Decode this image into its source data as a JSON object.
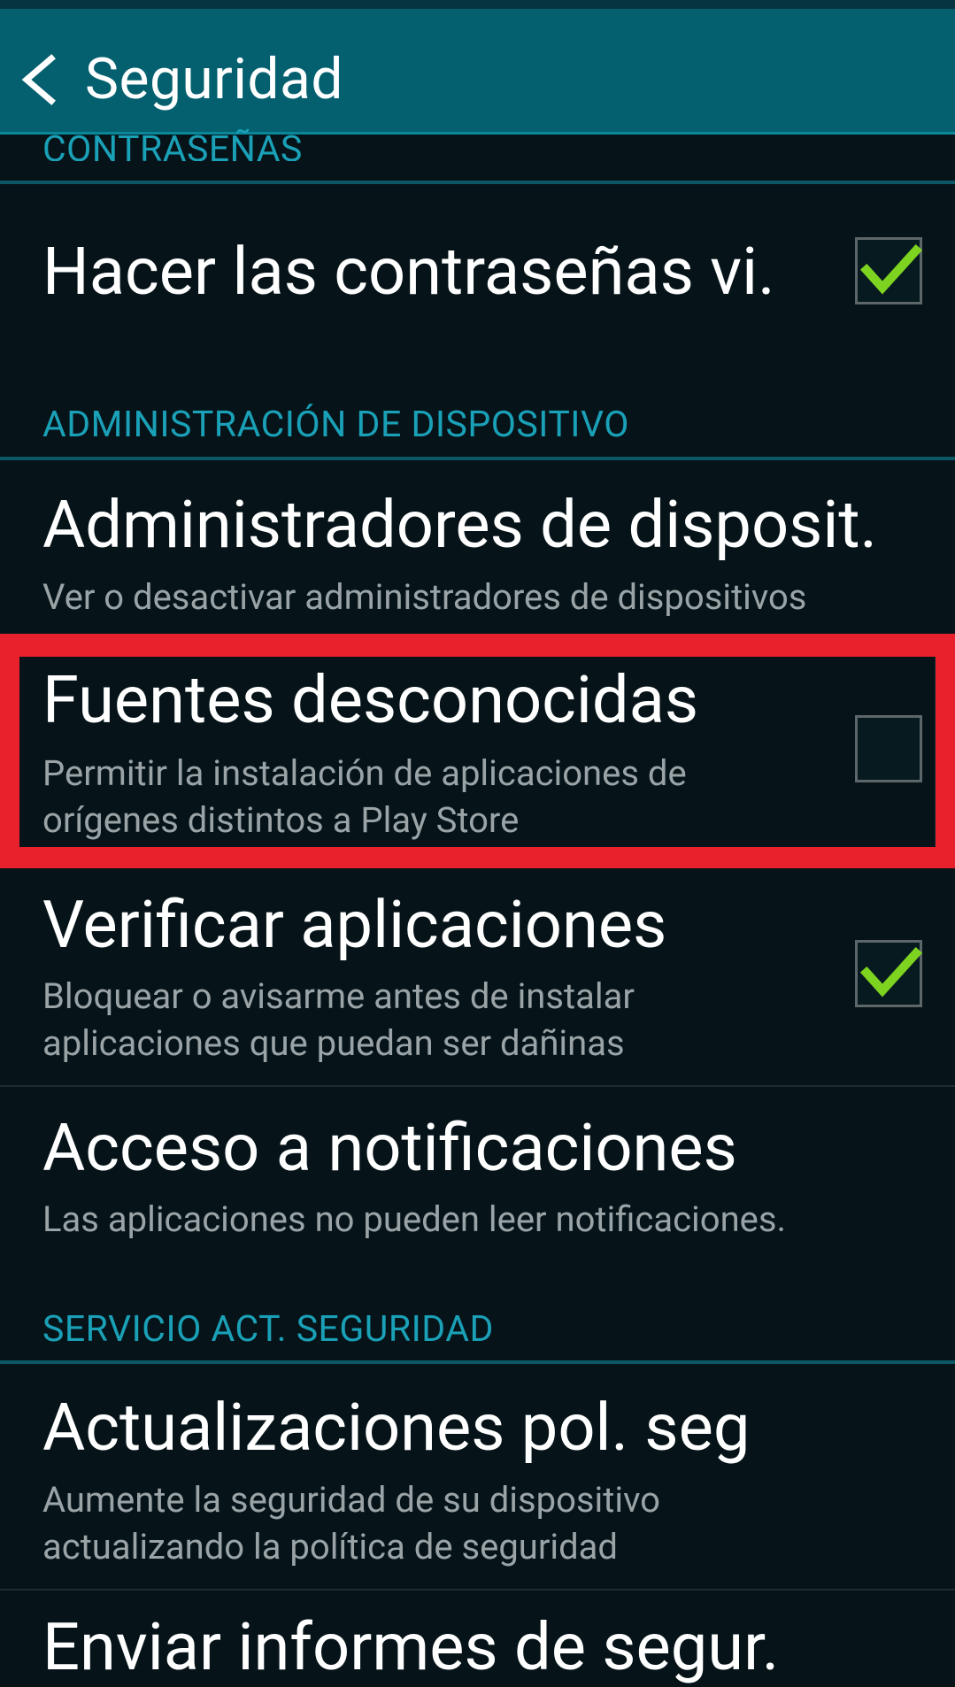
{
  "header": {
    "title": "Seguridad"
  },
  "sections": {
    "passwords": "CONTRASEÑAS",
    "device_admin": "ADMINISTRACIÓN DE DISPOSITIVO",
    "security_service": "SERVICIO ACT. SEGURIDAD"
  },
  "items": {
    "show_passwords": {
      "title": "Hacer las contraseñas vi.",
      "checked": true
    },
    "device_admins": {
      "title": "Administradores de disposit.",
      "summary": "Ver o desactivar administradores de dispositivos"
    },
    "unknown_sources": {
      "title": "Fuentes desconocidas",
      "summary_line1": "Permitir la instalación de aplicaciones de",
      "summary_line2": "orígenes distintos a Play Store",
      "checked": false
    },
    "verify_apps": {
      "title": "Verificar aplicaciones",
      "summary_line1": "Bloquear o avisarme antes de instalar",
      "summary_line2": "aplicaciones que puedan ser dañinas",
      "checked": true
    },
    "notification_access": {
      "title": "Acceso a notificaciones",
      "summary": "Las aplicaciones no pueden leer notificaciones."
    },
    "policy_updates": {
      "title": "Actualizaciones pol. seg",
      "summary_line1": "Aumente la seguridad de su dispositivo",
      "summary_line2": "actualizando la política de seguridad"
    },
    "send_reports": {
      "title": "Enviar informes de segur."
    }
  },
  "colors": {
    "accent": "#1aa0b7",
    "topbar": "#04606f",
    "background": "#061419",
    "check": "#7ed321",
    "highlight": "#e8212d"
  },
  "icons": {
    "back": "chevron-left-icon",
    "check": "checkmark-icon"
  }
}
